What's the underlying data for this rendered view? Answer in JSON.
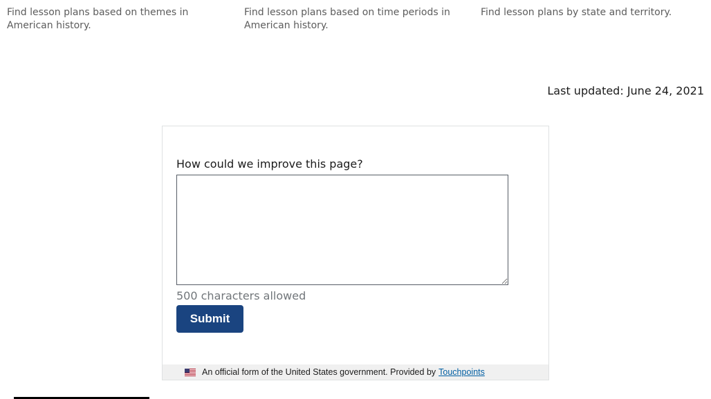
{
  "cards": [
    {
      "description": "Find lesson plans based on themes in American history."
    },
    {
      "description": "Find lesson plans based on time periods in American history."
    },
    {
      "description": "Find lesson plans by state and territory."
    }
  ],
  "last_updated": "Last updated: June 24, 2021",
  "feedback": {
    "question": "How could we improve this page?",
    "textarea_value": "",
    "char_limit_text": "500 characters allowed",
    "submit_label": "Submit",
    "footer_text": "An official form of the United States government. Provided by",
    "footer_link": "Touchpoints",
    "flag_icon": "us-flag-icon"
  },
  "colors": {
    "primary_button": "#1a4480",
    "link": "#005ea2",
    "muted_text": "#5c5c5c",
    "footer_bg": "#f0f0f0"
  }
}
